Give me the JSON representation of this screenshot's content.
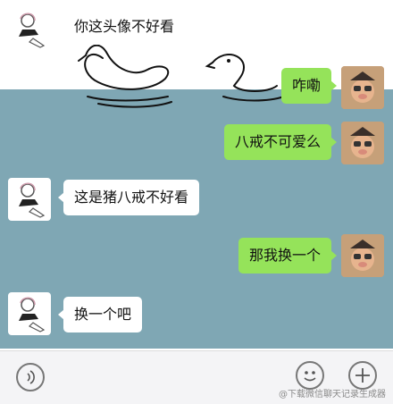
{
  "messages": [
    {
      "side": "left",
      "text": "你这头像不好看"
    },
    {
      "side": "right",
      "text": "咋嘞"
    },
    {
      "side": "right",
      "text": "八戒不可爱么"
    },
    {
      "side": "left",
      "text": "这是猪八戒不好看"
    },
    {
      "side": "right",
      "text": "那我换一个"
    },
    {
      "side": "left",
      "text": "换一个吧"
    }
  ],
  "toolbar": {
    "voice_icon": "voice-icon",
    "emoji_icon": "emoji-icon",
    "plus_icon": "plus-icon"
  },
  "watermark": "@下载微信聊天记录生成器",
  "colors": {
    "water": "#7fa7b4",
    "bubble_right": "#95e35a",
    "bubble_left": "#ffffff",
    "toolbar": "#f4f4f6"
  }
}
